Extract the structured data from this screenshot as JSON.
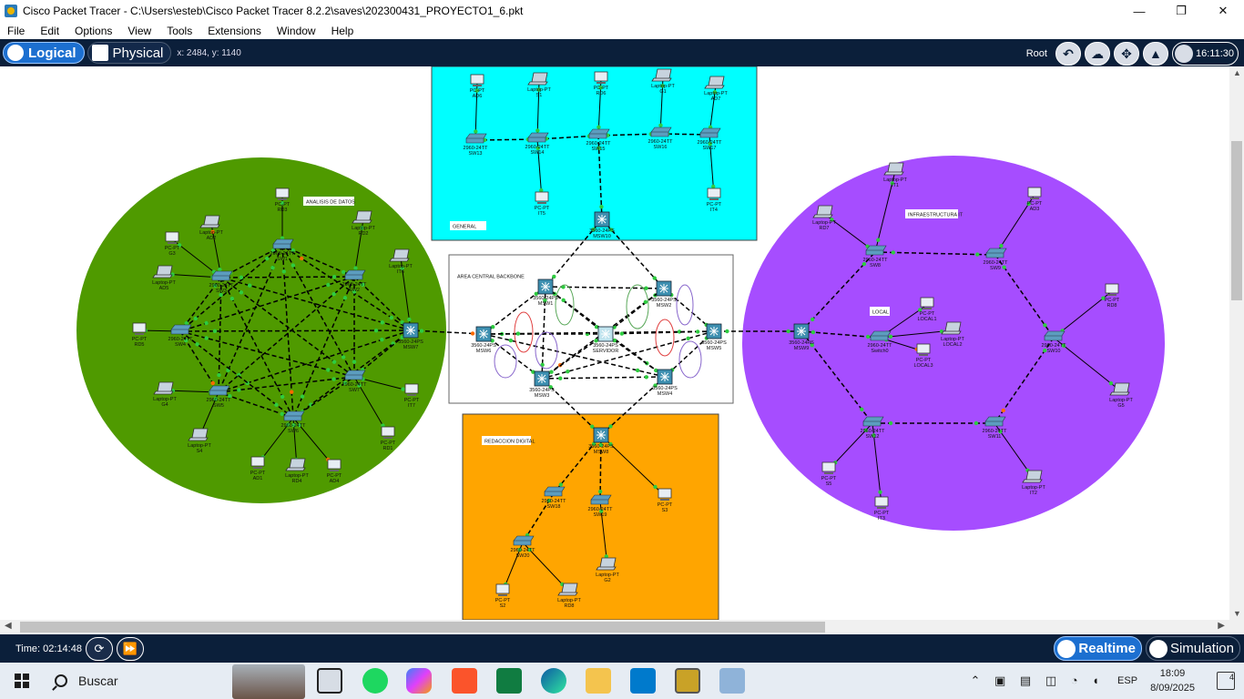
{
  "window": {
    "title": "Cisco Packet Tracer - C:\\Users\\esteb\\Cisco Packet Tracer 8.2.2\\saves\\202300431_PROYECTO1_6.pkt",
    "minimize": "—",
    "maximize": "❐",
    "close": "✕"
  },
  "menu": [
    "File",
    "Edit",
    "Options",
    "View",
    "Tools",
    "Extensions",
    "Window",
    "Help"
  ],
  "toolbar": {
    "logical_label": "Logical",
    "physical_label": "Physical",
    "coords": "x: 2484, y: 1140",
    "root_label": "Root",
    "clock": "16:11:30"
  },
  "workspace": {
    "areas": [
      {
        "id": "general",
        "label": "GENERAL",
        "color": "#00ffff"
      },
      {
        "id": "backbone",
        "label": "AREA CENTRAL BACKBONE",
        "color": "#ffffff"
      },
      {
        "id": "redaccion",
        "label": "REDACCION DIGITAL",
        "color": "#ffa500"
      },
      {
        "id": "analisis",
        "label": "ANALISIS DE DATOS",
        "color": "#4f9a00"
      },
      {
        "id": "infra",
        "label": "INFRAESTRUCTURA IT",
        "color": "#a64dff"
      },
      {
        "id": "local",
        "label": "LOCAL"
      }
    ],
    "devices": [
      {
        "id": "g_ad6",
        "type": "pc",
        "model": "PC-PT",
        "name": "AD6"
      },
      {
        "id": "g_s1",
        "type": "laptop",
        "model": "Laptop-PT",
        "name": "S1"
      },
      {
        "id": "g_rd6",
        "type": "pc",
        "model": "PC-PT",
        "name": "RD6"
      },
      {
        "id": "g_g1",
        "type": "laptop",
        "model": "Laptop-PT",
        "name": "G1"
      },
      {
        "id": "g_ad7",
        "type": "laptop",
        "model": "Laptop-PT",
        "name": "AD7"
      },
      {
        "id": "sw13",
        "type": "switch",
        "model": "2960-24TT",
        "name": "SW13"
      },
      {
        "id": "sw14",
        "type": "switch",
        "model": "2960-24TT",
        "name": "SW14"
      },
      {
        "id": "sw15",
        "type": "switch",
        "model": "2960-24TT",
        "name": "SW15"
      },
      {
        "id": "sw16",
        "type": "switch",
        "model": "2960-24TT",
        "name": "SW16"
      },
      {
        "id": "sw17",
        "type": "switch",
        "model": "2960-24TT",
        "name": "SW17"
      },
      {
        "id": "g_it5",
        "type": "pc",
        "model": "PC-PT",
        "name": "IT5"
      },
      {
        "id": "g_it4",
        "type": "pc",
        "model": "PC-PT",
        "name": "IT4"
      },
      {
        "id": "msw10",
        "type": "mlswitch",
        "model": "3560-24PS",
        "name": "MSW10"
      },
      {
        "id": "msw1",
        "type": "mlswitch",
        "model": "3560-24PS",
        "name": "MSW1"
      },
      {
        "id": "msw2",
        "type": "mlswitch",
        "model": "3560-24PS",
        "name": "MSW2"
      },
      {
        "id": "msw6",
        "type": "mlswitch",
        "model": "3560-24PS",
        "name": "MSW6"
      },
      {
        "id": "servidor",
        "type": "mlswitch",
        "model": "3560-24PS",
        "name": "SERVIDOR"
      },
      {
        "id": "msw5",
        "type": "mlswitch",
        "model": "3560-24PS",
        "name": "MSW5"
      },
      {
        "id": "msw3",
        "type": "mlswitch",
        "model": "3560-24PS",
        "name": "MSW3"
      },
      {
        "id": "msw4",
        "type": "mlswitch",
        "model": "3560-24PS",
        "name": "MSW4"
      },
      {
        "id": "msw7",
        "type": "mlswitch",
        "model": "3560-24PS",
        "name": "MSW7"
      },
      {
        "id": "msw8",
        "type": "mlswitch",
        "model": "3560-24PS",
        "name": "MSW8"
      },
      {
        "id": "msw9",
        "type": "mlswitch",
        "model": "3560-24PS",
        "name": "MSW9"
      },
      {
        "id": "sw18",
        "type": "switch",
        "model": "2960-24TT",
        "name": "SW18"
      },
      {
        "id": "sw19",
        "type": "switch",
        "model": "2960-24TT",
        "name": "SW19"
      },
      {
        "id": "sw20",
        "type": "switch",
        "model": "2960-24TT",
        "name": "SW20"
      },
      {
        "id": "r_s3",
        "type": "pc",
        "model": "PC-PT",
        "name": "S3"
      },
      {
        "id": "r_g2",
        "type": "laptop",
        "model": "Laptop-PT",
        "name": "G2"
      },
      {
        "id": "r_s2",
        "type": "pc",
        "model": "PC-PT",
        "name": "S2"
      },
      {
        "id": "r_rd8",
        "type": "laptop",
        "model": "Laptop-PT",
        "name": "RD8"
      },
      {
        "id": "sw1",
        "type": "switch",
        "model": "2960-24TT",
        "name": "SW1"
      },
      {
        "id": "sw2",
        "type": "switch",
        "model": "2960-24TT",
        "name": "SW2"
      },
      {
        "id": "sw3",
        "type": "switch",
        "model": "2960-24TT",
        "name": "SW3"
      },
      {
        "id": "sw4",
        "type": "switch",
        "model": "2960-24TT",
        "name": "SW4"
      },
      {
        "id": "sw5",
        "type": "switch",
        "model": "2960-24TT",
        "name": "SW5"
      },
      {
        "id": "sw6",
        "type": "switch",
        "model": "2960-24TT",
        "name": "SW6"
      },
      {
        "id": "sw7",
        "type": "switch",
        "model": "2960-24TT",
        "name": "SW7"
      },
      {
        "id": "a_rd3",
        "type": "pc",
        "model": "PC-PT",
        "name": "RD3"
      },
      {
        "id": "a_rd2",
        "type": "laptop",
        "model": "Laptop-PT",
        "name": "RD2"
      },
      {
        "id": "a_ad2",
        "type": "laptop",
        "model": "Laptop-PT",
        "name": "AD2"
      },
      {
        "id": "a_g3",
        "type": "pc",
        "model": "PC-PT",
        "name": "G3"
      },
      {
        "id": "a_it6",
        "type": "laptop",
        "model": "Laptop-PT",
        "name": "IT6"
      },
      {
        "id": "a_ad5",
        "type": "laptop",
        "model": "Laptop-PT",
        "name": "AD5"
      },
      {
        "id": "a_rd5",
        "type": "pc",
        "model": "PC-PT",
        "name": "RD5"
      },
      {
        "id": "a_g4",
        "type": "laptop",
        "model": "Laptop-PT",
        "name": "G4"
      },
      {
        "id": "a_it7",
        "type": "pc",
        "model": "PC-PT",
        "name": "IT7"
      },
      {
        "id": "a_rd1",
        "type": "pc",
        "model": "PC-PT",
        "name": "RD1"
      },
      {
        "id": "a_s4",
        "type": "laptop",
        "model": "Laptop-PT",
        "name": "S4"
      },
      {
        "id": "a_ad1",
        "type": "pc",
        "model": "PC-PT",
        "name": "AD1"
      },
      {
        "id": "a_rd4",
        "type": "laptop",
        "model": "Laptop-PT",
        "name": "RD4"
      },
      {
        "id": "a_ad4",
        "type": "pc",
        "model": "PC-PT",
        "name": "AD4"
      },
      {
        "id": "sw8",
        "type": "switch",
        "model": "2960-24TT",
        "name": "SW8"
      },
      {
        "id": "sw9",
        "type": "switch",
        "model": "2960-24TT",
        "name": "SW9"
      },
      {
        "id": "sw10",
        "type": "switch",
        "model": "2960-24TT",
        "name": "SW10"
      },
      {
        "id": "sw11",
        "type": "switch",
        "model": "2960-24TT",
        "name": "SW11"
      },
      {
        "id": "sw12",
        "type": "switch",
        "model": "2960-24TT",
        "name": "SW12"
      },
      {
        "id": "switch0",
        "type": "switch",
        "model": "2960-24TT",
        "name": "Switch0"
      },
      {
        "id": "i_it1",
        "type": "laptop",
        "model": "Laptop-PT",
        "name": "IT1"
      },
      {
        "id": "i_rd7",
        "type": "laptop",
        "model": "Laptop-PT",
        "name": "RD7"
      },
      {
        "id": "i_ad3",
        "type": "pc",
        "model": "PC-PT",
        "name": "AD3"
      },
      {
        "id": "i_rd8",
        "type": "pc",
        "model": "PC-PT",
        "name": "RD8"
      },
      {
        "id": "i_g5",
        "type": "laptop",
        "model": "Laptop-PT",
        "name": "G5"
      },
      {
        "id": "i_it2",
        "type": "laptop",
        "model": "Laptop-PT",
        "name": "IT2"
      },
      {
        "id": "i_it3",
        "type": "pc",
        "model": "PC-PT",
        "name": "IT3"
      },
      {
        "id": "i_s5",
        "type": "pc",
        "model": "PC-PT",
        "name": "S5"
      },
      {
        "id": "local1",
        "type": "pc",
        "model": "PC-PT",
        "name": "LOCAL1"
      },
      {
        "id": "local2",
        "type": "laptop",
        "model": "Laptop-PT",
        "name": "LOCAL2"
      },
      {
        "id": "local3",
        "type": "pc",
        "model": "PC-PT",
        "name": "LOCAL3"
      }
    ]
  },
  "status": {
    "time": "Time: 02:14:48",
    "realtime_label": "Realtime",
    "simulation_label": "Simulation"
  },
  "taskbar": {
    "search_label": "Buscar",
    "language": "ESP",
    "time": "18:09",
    "date": "8/09/2025",
    "notifications": "4"
  }
}
